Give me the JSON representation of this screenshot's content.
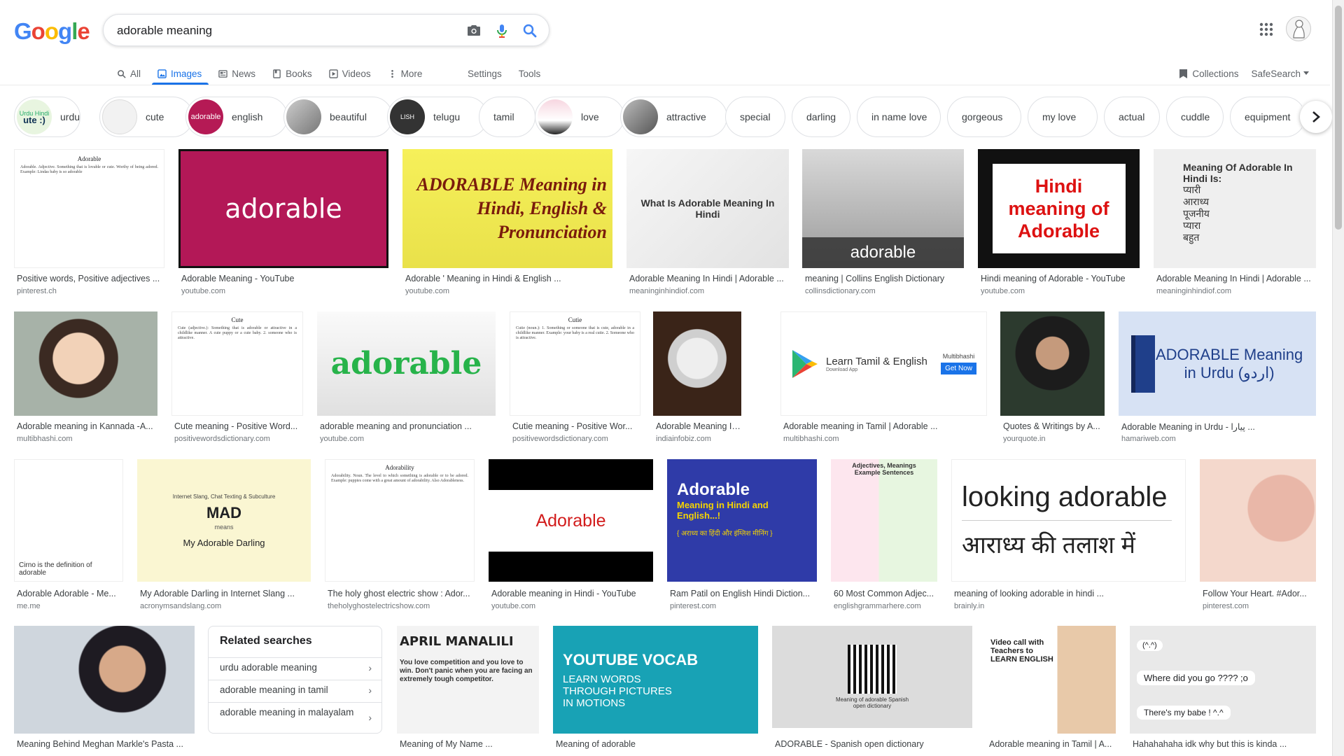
{
  "search": {
    "query": "adorable meaning"
  },
  "tabs": [
    {
      "label": "All",
      "icon": "search-icon"
    },
    {
      "label": "Images",
      "icon": "image-icon"
    },
    {
      "label": "News",
      "icon": "news-icon"
    },
    {
      "label": "Books",
      "icon": "book-icon"
    },
    {
      "label": "Videos",
      "icon": "video-icon"
    },
    {
      "label": "More",
      "icon": "more-vert-icon"
    }
  ],
  "tools": {
    "settings": "Settings",
    "tools": "Tools"
  },
  "header_right": {
    "collections": "Collections",
    "safesearch": "SafeSearch"
  },
  "chips": [
    "urdu",
    "cute",
    "english",
    "beautiful",
    "telugu",
    "tamil",
    "love",
    "attractive",
    "special",
    "darling",
    "in name love",
    "gorgeous",
    "my love",
    "actual",
    "cuddle",
    "equipment"
  ],
  "results": [
    {
      "title": "Positive words, Positive adjectives ...",
      "source": "pinterest.ch",
      "img_text": "Adorable"
    },
    {
      "title": "Adorable Meaning - YouTube",
      "source": "youtube.com",
      "img_text": "adorable"
    },
    {
      "title": "Adorable ' Meaning in Hindi & English ...",
      "source": "youtube.com",
      "img_text": "ADORABLE Meaning in Hindi, English & Pronunciation"
    },
    {
      "title": "Adorable Meaning In Hindi | Adorable ...",
      "source": "meaninginhindiof.com",
      "img_text": "What Is Adorable Meaning In Hindi"
    },
    {
      "title": "meaning | Collins English Dictionary",
      "source": "collinsdictionary.com",
      "img_text": "adorable"
    },
    {
      "title": "Hindi meaning of Adorable - YouTube",
      "source": "youtube.com",
      "img_text": "Hindi meaning of Adorable"
    },
    {
      "title": "Adorable Meaning In Hindi | Adorable ...",
      "source": "meaninginhindiof.com",
      "img_text": "Meaning Of Adorable In Hindi Is:"
    },
    {
      "title": "Adorable meaning in Kannada -A...",
      "source": "multibhashi.com",
      "img_text": ""
    },
    {
      "title": "Cute meaning - Positive Word...",
      "source": "positivewordsdictionary.com",
      "img_text": "Cute"
    },
    {
      "title": "adorable meaning and pronunciation ...",
      "source": "youtube.com",
      "img_text": "adorable"
    },
    {
      "title": "Cutie meaning - Positive Wor...",
      "source": "positivewordsdictionary.com",
      "img_text": "Cutie"
    },
    {
      "title": "Adorable Meaning In Hin...",
      "source": "indiainfobiz.com",
      "img_text": ""
    },
    {
      "title": "Adorable meaning in Tamil | Adorable ...",
      "source": "multibhashi.com",
      "img_text": "Learn Tamil & English"
    },
    {
      "title": "Quotes & Writings by A...",
      "source": "yourquote.in",
      "img_text": ""
    },
    {
      "title": "Adorable Meaning in Urdu - پیارا ...",
      "source": "hamariweb.com",
      "img_text": "ADORABLE Meaning in Urdu (اردو)"
    },
    {
      "title": "Adorable Adorable - Me...",
      "source": "me.me",
      "img_text": "Cirno is the definition of adorable"
    },
    {
      "title": "My Adorable Darling in Internet Slang ...",
      "source": "acronymsandslang.com",
      "img_text": "MAD"
    },
    {
      "title": "The holy ghost electric show : Ador...",
      "source": "theholyghostelectricshow.com",
      "img_text": "Adorability"
    },
    {
      "title": "Adorable meaning in Hindi - YouTube",
      "source": "youtube.com",
      "img_text": "Adorable"
    },
    {
      "title": "Ram Patil on English Hindi Diction...",
      "source": "pinterest.com",
      "img_text": "Adorable"
    },
    {
      "title": "60 Most Common Adjec...",
      "source": "englishgrammarhere.com",
      "img_text": "Adjectives, Meanings Example Sentences"
    },
    {
      "title": "meaning of looking adorable in hindi ...",
      "source": "brainly.in",
      "img_text": "looking adorable"
    },
    {
      "title": "Follow Your Heart. #Ador...",
      "source": "pinterest.com",
      "img_text": ""
    },
    {
      "title": "Meaning Behind Meghan Markle's Pasta ...",
      "source": "",
      "img_text": ""
    },
    {
      "title": "Meaning of My Name ...",
      "source": "",
      "img_text": "APRIL MANALILI"
    },
    {
      "title": "Meaning of adorable",
      "source": "",
      "img_text": "YOUTUBE VOCAB"
    },
    {
      "title": "ADORABLE - Spanish open dictionary",
      "source": "",
      "img_text": "Meaning of adorable Spanish open dictionary"
    },
    {
      "title": "Adorable meaning in Tamil | A...",
      "source": "",
      "img_text": "Video call with Teachers to LEARN ENGLISH"
    },
    {
      "title": "Hahahahaha idk why but this is kinda ...",
      "source": "",
      "img_text": "Where did you go ???? ;o"
    }
  ],
  "related": {
    "title": "Related searches",
    "items": [
      "urdu adorable meaning",
      "adorable meaning in tamil",
      "adorable meaning in malayalam"
    ]
  },
  "img_extra": {
    "sub_hindi_line": "Hindi",
    "hindi_words": [
      "प्यारी",
      "आराध्य",
      "पूजनीय",
      "प्यारा",
      "बहुत"
    ],
    "urdu_label": "Meaning in Urdu (اردو)",
    "mad_sub": "Internet Slang, Chat Texting & Subculture",
    "mad_means": "means",
    "mad_full": "My Adorable Darling",
    "looking_hindi": "आराध्य की तलाश में",
    "tamil_app_sub": "Download App",
    "tamil_get": "Get Now",
    "tamil_brand": "Multibhashi",
    "ram_hindi": "{ अराध्य का हिंदी और इंग्लिश मीनिंग }",
    "meaning_of": "Meaning in Hindi and English...!",
    "vocab_sub": "LEARN WORDS THROUGH PICTURES IN MOTIONS",
    "april_sub": "You love competition and you love to win. Don't panic when you are facing an extremely tough competitor.",
    "chat1": "Where did you go ???? ;o",
    "chat2": "There's my babe ! ^.^",
    "chat_emote": "(^.^)",
    "urdu_hindi_chip": "Urdu Hindi"
  }
}
